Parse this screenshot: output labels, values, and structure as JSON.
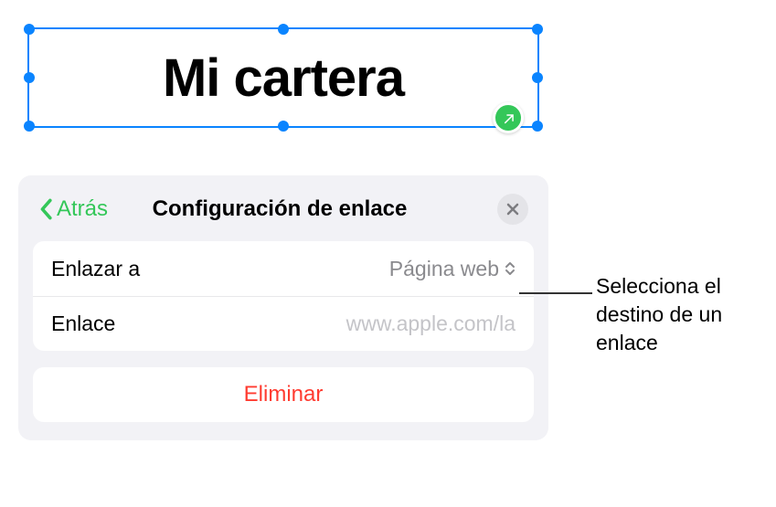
{
  "selection": {
    "text": "Mi cartera"
  },
  "panel": {
    "back_label": "Atrás",
    "title": "Configuración de enlace",
    "rows": {
      "link_to": {
        "label": "Enlazar a",
        "value": "Página web"
      },
      "link": {
        "label": "Enlace",
        "placeholder": "www.apple.com/la"
      }
    },
    "delete_label": "Eliminar"
  },
  "callout": {
    "text": "Selecciona el destino de un enlace"
  },
  "colors": {
    "accent_green": "#34c759",
    "selection_blue": "#0a84ff",
    "destructive_red": "#ff3b30",
    "panel_bg": "#f2f2f6"
  }
}
